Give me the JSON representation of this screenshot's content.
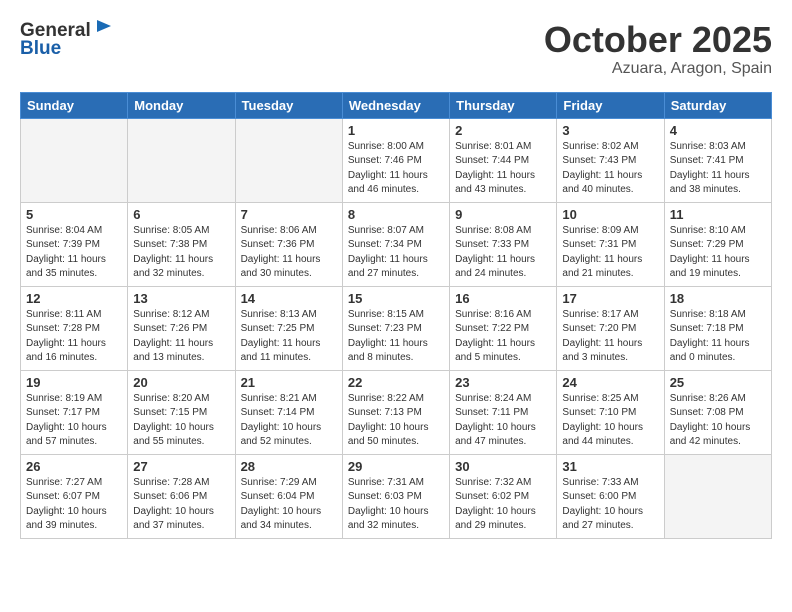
{
  "header": {
    "logo_general": "General",
    "logo_blue": "Blue",
    "month": "October 2025",
    "location": "Azuara, Aragon, Spain"
  },
  "weekdays": [
    "Sunday",
    "Monday",
    "Tuesday",
    "Wednesday",
    "Thursday",
    "Friday",
    "Saturday"
  ],
  "weeks": [
    [
      {
        "day": "",
        "info": ""
      },
      {
        "day": "",
        "info": ""
      },
      {
        "day": "",
        "info": ""
      },
      {
        "day": "1",
        "info": "Sunrise: 8:00 AM\nSunset: 7:46 PM\nDaylight: 11 hours\nand 46 minutes."
      },
      {
        "day": "2",
        "info": "Sunrise: 8:01 AM\nSunset: 7:44 PM\nDaylight: 11 hours\nand 43 minutes."
      },
      {
        "day": "3",
        "info": "Sunrise: 8:02 AM\nSunset: 7:43 PM\nDaylight: 11 hours\nand 40 minutes."
      },
      {
        "day": "4",
        "info": "Sunrise: 8:03 AM\nSunset: 7:41 PM\nDaylight: 11 hours\nand 38 minutes."
      }
    ],
    [
      {
        "day": "5",
        "info": "Sunrise: 8:04 AM\nSunset: 7:39 PM\nDaylight: 11 hours\nand 35 minutes."
      },
      {
        "day": "6",
        "info": "Sunrise: 8:05 AM\nSunset: 7:38 PM\nDaylight: 11 hours\nand 32 minutes."
      },
      {
        "day": "7",
        "info": "Sunrise: 8:06 AM\nSunset: 7:36 PM\nDaylight: 11 hours\nand 30 minutes."
      },
      {
        "day": "8",
        "info": "Sunrise: 8:07 AM\nSunset: 7:34 PM\nDaylight: 11 hours\nand 27 minutes."
      },
      {
        "day": "9",
        "info": "Sunrise: 8:08 AM\nSunset: 7:33 PM\nDaylight: 11 hours\nand 24 minutes."
      },
      {
        "day": "10",
        "info": "Sunrise: 8:09 AM\nSunset: 7:31 PM\nDaylight: 11 hours\nand 21 minutes."
      },
      {
        "day": "11",
        "info": "Sunrise: 8:10 AM\nSunset: 7:29 PM\nDaylight: 11 hours\nand 19 minutes."
      }
    ],
    [
      {
        "day": "12",
        "info": "Sunrise: 8:11 AM\nSunset: 7:28 PM\nDaylight: 11 hours\nand 16 minutes."
      },
      {
        "day": "13",
        "info": "Sunrise: 8:12 AM\nSunset: 7:26 PM\nDaylight: 11 hours\nand 13 minutes."
      },
      {
        "day": "14",
        "info": "Sunrise: 8:13 AM\nSunset: 7:25 PM\nDaylight: 11 hours\nand 11 minutes."
      },
      {
        "day": "15",
        "info": "Sunrise: 8:15 AM\nSunset: 7:23 PM\nDaylight: 11 hours\nand 8 minutes."
      },
      {
        "day": "16",
        "info": "Sunrise: 8:16 AM\nSunset: 7:22 PM\nDaylight: 11 hours\nand 5 minutes."
      },
      {
        "day": "17",
        "info": "Sunrise: 8:17 AM\nSunset: 7:20 PM\nDaylight: 11 hours\nand 3 minutes."
      },
      {
        "day": "18",
        "info": "Sunrise: 8:18 AM\nSunset: 7:18 PM\nDaylight: 11 hours\nand 0 minutes."
      }
    ],
    [
      {
        "day": "19",
        "info": "Sunrise: 8:19 AM\nSunset: 7:17 PM\nDaylight: 10 hours\nand 57 minutes."
      },
      {
        "day": "20",
        "info": "Sunrise: 8:20 AM\nSunset: 7:15 PM\nDaylight: 10 hours\nand 55 minutes."
      },
      {
        "day": "21",
        "info": "Sunrise: 8:21 AM\nSunset: 7:14 PM\nDaylight: 10 hours\nand 52 minutes."
      },
      {
        "day": "22",
        "info": "Sunrise: 8:22 AM\nSunset: 7:13 PM\nDaylight: 10 hours\nand 50 minutes."
      },
      {
        "day": "23",
        "info": "Sunrise: 8:24 AM\nSunset: 7:11 PM\nDaylight: 10 hours\nand 47 minutes."
      },
      {
        "day": "24",
        "info": "Sunrise: 8:25 AM\nSunset: 7:10 PM\nDaylight: 10 hours\nand 44 minutes."
      },
      {
        "day": "25",
        "info": "Sunrise: 8:26 AM\nSunset: 7:08 PM\nDaylight: 10 hours\nand 42 minutes."
      }
    ],
    [
      {
        "day": "26",
        "info": "Sunrise: 7:27 AM\nSunset: 6:07 PM\nDaylight: 10 hours\nand 39 minutes."
      },
      {
        "day": "27",
        "info": "Sunrise: 7:28 AM\nSunset: 6:06 PM\nDaylight: 10 hours\nand 37 minutes."
      },
      {
        "day": "28",
        "info": "Sunrise: 7:29 AM\nSunset: 6:04 PM\nDaylight: 10 hours\nand 34 minutes."
      },
      {
        "day": "29",
        "info": "Sunrise: 7:31 AM\nSunset: 6:03 PM\nDaylight: 10 hours\nand 32 minutes."
      },
      {
        "day": "30",
        "info": "Sunrise: 7:32 AM\nSunset: 6:02 PM\nDaylight: 10 hours\nand 29 minutes."
      },
      {
        "day": "31",
        "info": "Sunrise: 7:33 AM\nSunset: 6:00 PM\nDaylight: 10 hours\nand 27 minutes."
      },
      {
        "day": "",
        "info": ""
      }
    ]
  ]
}
